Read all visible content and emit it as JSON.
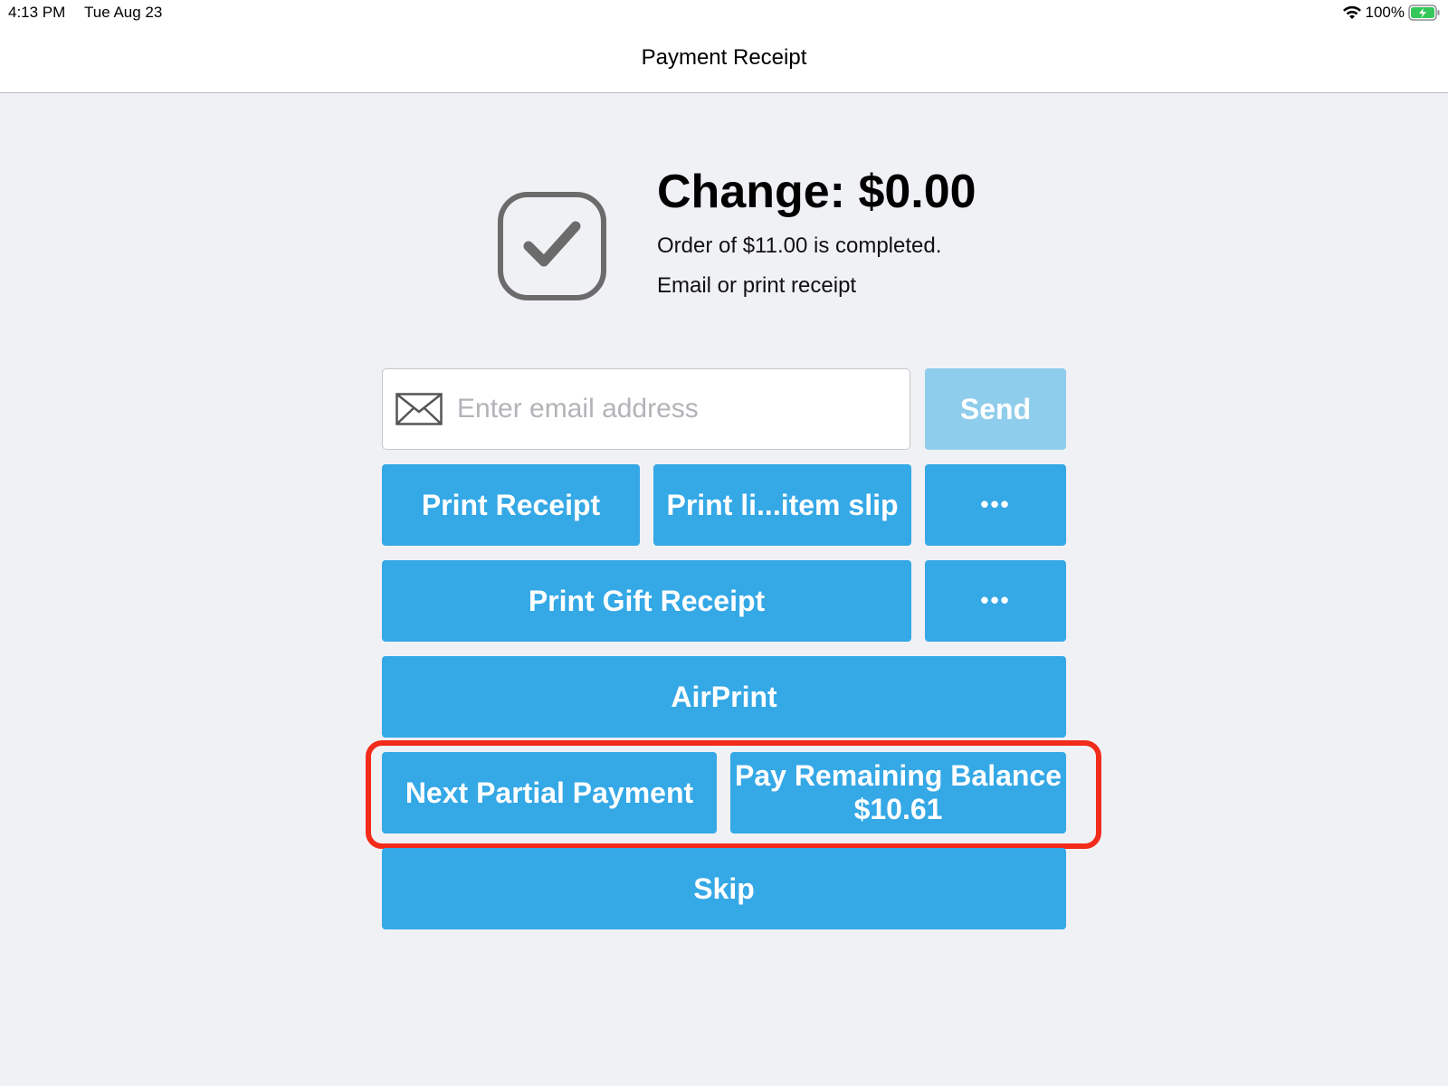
{
  "status_bar": {
    "time": "4:13 PM",
    "date": "Tue Aug 23",
    "battery": "100%"
  },
  "nav": {
    "title": "Payment Receipt"
  },
  "summary": {
    "change": "Change: $0.00",
    "order_text": "Order of $11.00 is completed.",
    "prompt": "Email or print receipt"
  },
  "email": {
    "placeholder": "Enter email address",
    "value": ""
  },
  "buttons": {
    "send": "Send",
    "print_receipt": "Print Receipt",
    "print_line_item_slip": "Print li...item slip",
    "more": "•••",
    "print_gift_receipt": "Print Gift Receipt",
    "airprint": "AirPrint",
    "next_partial_payment": "Next Partial Payment",
    "pay_remaining_label": "Pay Remaining Balance",
    "pay_remaining_amount": "$10.61",
    "skip": "Skip"
  },
  "colors": {
    "accent": "#35a8e6",
    "disabled_accent": "#8fcdec",
    "highlight": "#f22b1a",
    "background": "#f0f1f5"
  },
  "icons": {
    "status": [
      "wifi-icon",
      "battery-icon"
    ],
    "summary": "checkmark-square-icon",
    "email": "envelope-icon"
  }
}
